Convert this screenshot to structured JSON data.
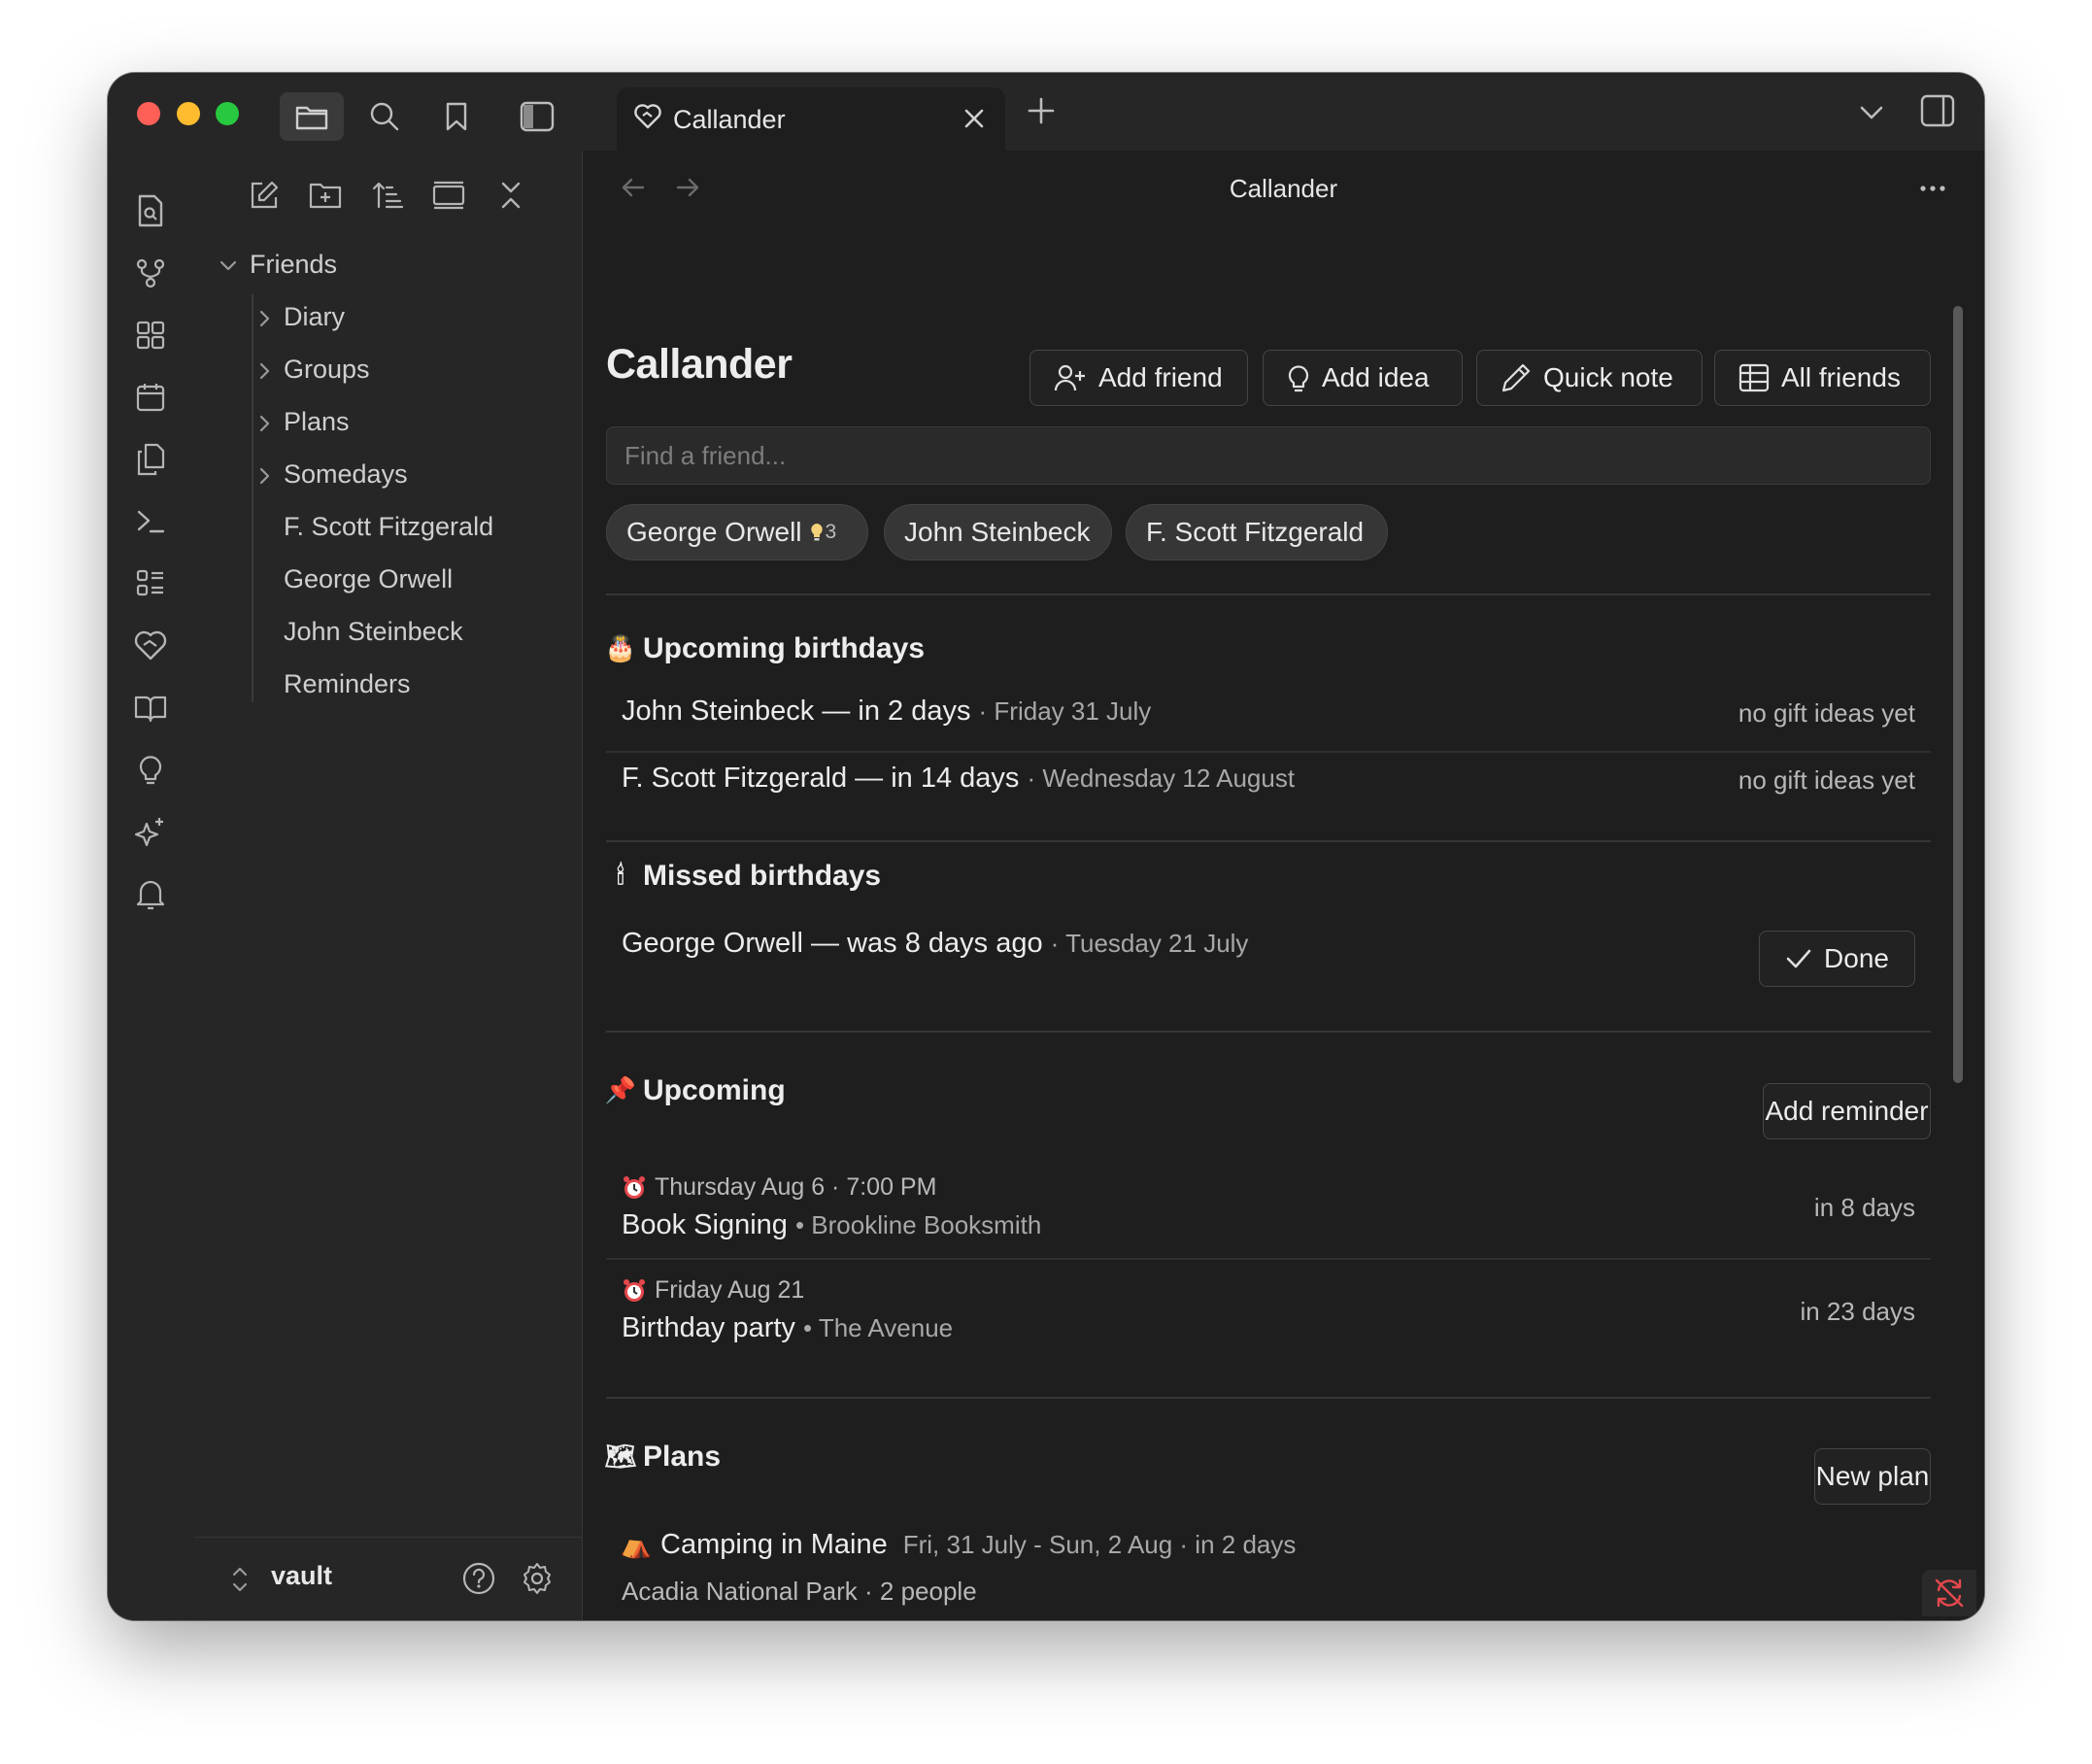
{
  "tab": {
    "title": "Callander"
  },
  "view": {
    "title": "Callander"
  },
  "sidebar": {
    "root": "Friends",
    "folders": [
      "Diary",
      "Groups",
      "Plans",
      "Somedays"
    ],
    "files": [
      "F. Scott Fitzgerald",
      "George Orwell",
      "John Steinbeck",
      "Reminders"
    ],
    "vault": "vault"
  },
  "page": {
    "title": "Callander",
    "buttons": {
      "add_friend": "Add friend",
      "add_idea": "Add idea",
      "quick_note": "Quick note",
      "all_friends": "All friends"
    },
    "search_placeholder": "Find a friend...",
    "chips": [
      {
        "name": "George Orwell",
        "count": "3"
      },
      {
        "name": "John Steinbeck"
      },
      {
        "name": "F. Scott Fitzgerald"
      }
    ]
  },
  "upcoming_birthdays": {
    "heading": "Upcoming birthdays",
    "emoji": "🎂",
    "items": [
      {
        "main": "John Steinbeck — in 2 days",
        "date": "· Friday 31 July",
        "note": "no gift ideas yet"
      },
      {
        "main": "F. Scott Fitzgerald — in 14 days",
        "date": "· Wednesday 12 August",
        "note": "no gift ideas yet"
      }
    ]
  },
  "missed_birthdays": {
    "heading": "Missed birthdays",
    "emoji": "🕯",
    "items": [
      {
        "main": "George Orwell — was 8 days ago",
        "date": "· Tuesday 21 July",
        "action": "Done"
      }
    ]
  },
  "upcoming": {
    "heading": "Upcoming",
    "emoji": "📌",
    "button": "Add reminder",
    "items": [
      {
        "when": "Thursday Aug 6 · 7:00 PM",
        "title": "Book Signing",
        "where": "• Brookline Booksmith",
        "relative": "in 8 days"
      },
      {
        "when": "Friday Aug 21",
        "title": "Birthday party",
        "where": "• The Avenue",
        "relative": "in 23 days"
      }
    ]
  },
  "plans": {
    "heading": "Plans",
    "emoji": "🗺",
    "button": "New plan",
    "items": [
      {
        "emoji": "⛺",
        "title": "Camping in Maine",
        "dates": "Fri, 31 July - Sun, 2 Aug · in 2 days",
        "details": "Acadia National Park · 2 people"
      }
    ]
  },
  "colors": {
    "background": "#1e1e1e",
    "panel": "#262626",
    "accent_alert": "#e5484d"
  }
}
